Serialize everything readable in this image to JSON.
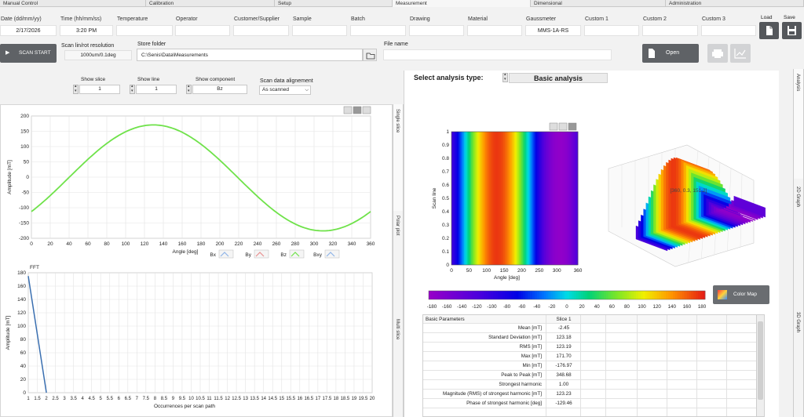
{
  "tabs": [
    "Manual Control",
    "Calibration",
    "Setup",
    "Measurement",
    "Dimensional",
    "Administration"
  ],
  "active_tab": "Measurement",
  "header_fields": [
    {
      "label": "Date (dd/mm/yy)",
      "value": "2/17/2026"
    },
    {
      "label": "Time (hh/mm/ss)",
      "value": "3:20 PM"
    },
    {
      "label": "Temperature",
      "value": ""
    },
    {
      "label": "Operator",
      "value": ""
    },
    {
      "label": "Customer/Supplier",
      "value": ""
    },
    {
      "label": "Sample",
      "value": ""
    },
    {
      "label": "Batch",
      "value": ""
    },
    {
      "label": "Drawing",
      "value": ""
    },
    {
      "label": "Material",
      "value": ""
    },
    {
      "label": "Gaussmeter",
      "value": "MMS-1A-RS"
    },
    {
      "label": "Custom 1",
      "value": ""
    },
    {
      "label": "Custom 2",
      "value": ""
    },
    {
      "label": "Custom 3",
      "value": ""
    }
  ],
  "load_label": "Load",
  "save_label": "Save",
  "scan_start_label": "SCAN START",
  "scan_res_label": "Scan lin/rot resolution",
  "scan_res_value": "1000um/0.1deg",
  "store_folder_label": "Store folder",
  "store_folder_value": "C:\\Senis\\Data\\Measurements",
  "file_name_label": "File name",
  "file_name_value": "",
  "open_label": "Open",
  "show_slice_label": "Show slice",
  "show_slice_value": "1",
  "show_line_label": "Show  line",
  "show_line_value": "1",
  "show_component_label": "Show component",
  "show_component_value": "Bz",
  "align_label": "Scan data alignement",
  "align_value": "As scanned",
  "vtabs_left": [
    "Single slice",
    "Polar plot",
    "Multi slice"
  ],
  "vtabs_right": [
    "Analysis",
    "2D Graph",
    "3D Graph"
  ],
  "analysis_type_label": "Select analysis type:",
  "analysis_type_value": "Basic analysis",
  "color_map_label": "Color Map",
  "chart_data": [
    {
      "type": "line",
      "xlabel": "Angle [deg]",
      "ylabel": "Amplitude [mT]",
      "xlim": [
        0,
        360
      ],
      "ylim": [
        -200,
        200
      ],
      "xticks": [
        0,
        20,
        40,
        60,
        80,
        100,
        120,
        140,
        160,
        180,
        200,
        220,
        240,
        260,
        280,
        300,
        320,
        340,
        360
      ],
      "yticks": [
        200,
        150,
        100,
        50,
        0,
        -50,
        -100,
        -150,
        -200
      ],
      "series": [
        {
          "name": "Bz",
          "color": "#6fe24a",
          "amplitude": 173.3,
          "offset": -2.45,
          "phase_deg": -129.46
        }
      ],
      "legend": [
        "Bx",
        "By",
        "Bz",
        "Bxy"
      ],
      "grid": true
    },
    {
      "type": "line",
      "title": "FFT",
      "xlabel": "Occurrences per scan path",
      "ylabel": "Amplitude [mT]",
      "xlim": [
        1,
        20
      ],
      "ylim": [
        0,
        180
      ],
      "xticks": [
        "1",
        "1.5",
        "2",
        "2.5",
        "3",
        "3.5",
        "4",
        "4.5",
        "5",
        "5.5",
        "6",
        "6.5",
        "7",
        "7.5",
        "8",
        "8.5",
        "9",
        "9.5",
        "10",
        "10.5",
        "11",
        "11.5",
        "12",
        "12.5",
        "13",
        "13.5",
        "14",
        "14.5",
        "15",
        "15.5",
        "16",
        "16.5",
        "17",
        "17.5",
        "18",
        "18.5",
        "19",
        "19.5",
        "20"
      ],
      "yticks": [
        180,
        160,
        140,
        120,
        100,
        80,
        60,
        40,
        20,
        0
      ],
      "series": [
        {
          "name": "FFT",
          "color": "#3a6fb0",
          "x": [
            1,
            2
          ],
          "y": [
            175,
            0
          ]
        }
      ],
      "grid": true
    },
    {
      "type": "heatmap",
      "xlabel": "Angle [deg]",
      "ylabel": "Scan line",
      "xlim": [
        0,
        360
      ],
      "ylim": [
        0,
        1
      ],
      "xticks": [
        0,
        50,
        100,
        150,
        200,
        250,
        300,
        360
      ],
      "yticks": [
        "1",
        "0.9",
        "0.8",
        "0.7",
        "0.6",
        "0.5",
        "0.4",
        "0.3",
        "0.2",
        "0.1",
        "0"
      ]
    },
    {
      "type": "surface",
      "cursor_label": "[360, 0.3, 151.2]"
    }
  ],
  "colorbar_ticks": [
    "-180",
    "-160",
    "-140",
    "-120",
    "-100",
    "-80",
    "-60",
    "-40",
    "-20",
    "0",
    "20",
    "40",
    "60",
    "80",
    "100",
    "120",
    "140",
    "160",
    "180"
  ],
  "table": {
    "header_key": "Basic Parameters",
    "header_col": "Slice 1",
    "rows": [
      {
        "k": "Mean [mT]",
        "v": "-2.45"
      },
      {
        "k": "Standard Deviation [mT]",
        "v": "123.18"
      },
      {
        "k": "RMS [mT]",
        "v": "123.19"
      },
      {
        "k": "Max [mT]",
        "v": "171.70"
      },
      {
        "k": "Min [mT]",
        "v": "-176.97"
      },
      {
        "k": "Peak to Peak [mT]",
        "v": "348.68"
      },
      {
        "k": "Strongest harmonic",
        "v": "1.00"
      },
      {
        "k": "Magnitude (RMS) of strongest harmonic [mT]",
        "v": "123.23"
      },
      {
        "k": "Phase of strongest harmonic [deg]",
        "v": "-129.46"
      }
    ]
  }
}
